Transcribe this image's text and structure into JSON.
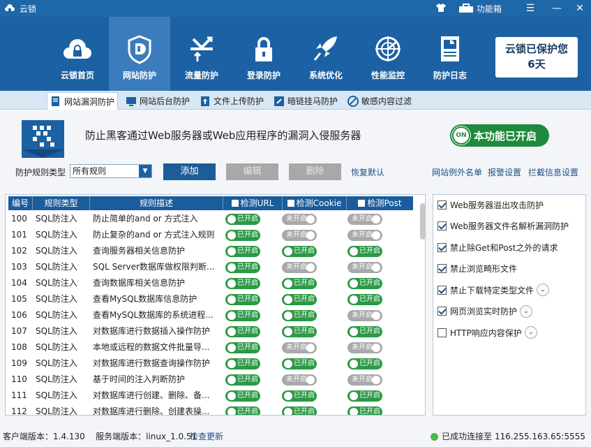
{
  "app": {
    "title": "云锁",
    "toolbox_label": "功能箱"
  },
  "nav": {
    "items": [
      {
        "label": "云锁首页",
        "icon": "cloud-lock-icon"
      },
      {
        "label": "网站防护",
        "icon": "shield-d-icon"
      },
      {
        "label": "流量防护",
        "icon": "traffic-icon"
      },
      {
        "label": "登录防护",
        "icon": "lock-icon"
      },
      {
        "label": "系统优化",
        "icon": "rocket-icon"
      },
      {
        "label": "性能监控",
        "icon": "radar-icon"
      },
      {
        "label": "防护日志",
        "icon": "report-icon"
      }
    ],
    "protect_line1": "云锁已保护您",
    "protect_line2": "6天"
  },
  "subnav": {
    "tabs": [
      {
        "label": "网站漏洞防护",
        "icon": "page-shield-icon"
      },
      {
        "label": "网站后台防护",
        "icon": "monitor-icon"
      },
      {
        "label": "文件上传防护",
        "icon": "upload-file-icon"
      },
      {
        "label": "暗链挂马防护",
        "icon": "link-icon"
      },
      {
        "label": "敏感内容过滤",
        "icon": "filter-icon"
      }
    ]
  },
  "banner": {
    "text": "防止黑客通过Web服务器或Web应用程序的漏洞入侵服务器",
    "status_on": "ON",
    "status_text": "本功能已开启"
  },
  "controls": {
    "rule_type_label": "防护规则类型",
    "rule_type_value": "所有规则",
    "add": "添加",
    "edit": "编辑",
    "delete": "删除",
    "restore": "恢复默认",
    "links": [
      "网站例外名单",
      "报警设置",
      "拦截信息设置"
    ]
  },
  "table": {
    "headers": [
      "编号",
      "规则类型",
      "规则描述",
      "检测URL",
      "检测Cookie",
      "检测Post"
    ],
    "on_label": "已开启",
    "off_label": "未开启",
    "rows": [
      {
        "id": "100",
        "type": "SQL防注入",
        "desc": "防止简单的and or 方式注入",
        "url": true,
        "cookie": false,
        "post": false
      },
      {
        "id": "101",
        "type": "SQL防注入",
        "desc": "防止复杂的and or 方式注入规则",
        "url": true,
        "cookie": false,
        "post": false
      },
      {
        "id": "102",
        "type": "SQL防注入",
        "desc": "查询服务器相关信息防护",
        "url": true,
        "cookie": true,
        "post": true
      },
      {
        "id": "103",
        "type": "SQL防注入",
        "desc": "SQL Server数据库做权限判断...",
        "url": true,
        "cookie": false,
        "post": false
      },
      {
        "id": "104",
        "type": "SQL防注入",
        "desc": "查询数据库相关信息防护",
        "url": true,
        "cookie": true,
        "post": true
      },
      {
        "id": "105",
        "type": "SQL防注入",
        "desc": "查看MySQL数据库信息防护",
        "url": true,
        "cookie": true,
        "post": true
      },
      {
        "id": "106",
        "type": "SQL防注入",
        "desc": "查看MySQL数据库的系统进程...",
        "url": true,
        "cookie": true,
        "post": false
      },
      {
        "id": "107",
        "type": "SQL防注入",
        "desc": "对数据库进行数据插入操作防护",
        "url": true,
        "cookie": true,
        "post": true
      },
      {
        "id": "108",
        "type": "SQL防注入",
        "desc": "本地或远程的数据文件批量导...",
        "url": true,
        "cookie": false,
        "post": false
      },
      {
        "id": "109",
        "type": "SQL防注入",
        "desc": "对数据库进行数据查询操作防护",
        "url": true,
        "cookie": true,
        "post": true
      },
      {
        "id": "110",
        "type": "SQL防注入",
        "desc": "基于时间的注入判断防护",
        "url": true,
        "cookie": false,
        "post": false
      },
      {
        "id": "111",
        "type": "SQL防注入",
        "desc": "对数据库进行创建、删除、备...",
        "url": true,
        "cookie": true,
        "post": true
      },
      {
        "id": "112",
        "type": "SQL防注入",
        "desc": "对数据库进行删除、创建表操...",
        "url": true,
        "cookie": true,
        "post": true
      }
    ]
  },
  "options": [
    {
      "label": "Web服务器溢出攻击防护",
      "checked": true,
      "expand": false
    },
    {
      "label": "Web服务器文件名解析漏洞防护",
      "checked": true,
      "expand": false
    },
    {
      "label": "禁止除Get和Post之外的请求",
      "checked": true,
      "expand": false
    },
    {
      "label": "禁止浏览畸形文件",
      "checked": true,
      "expand": false
    },
    {
      "label": "禁止下载特定类型文件",
      "checked": true,
      "expand": true
    },
    {
      "label": "网页浏览实时防护",
      "checked": true,
      "expand": true
    },
    {
      "label": "HTTP响应内容保护",
      "checked": false,
      "expand": true
    }
  ],
  "status": {
    "client_label": "客户端版本：",
    "client_version": "1.4.130",
    "server_label": "服务端版本：",
    "server_version": "linux_1.0.51",
    "check_update": "检查更新",
    "connected": "已成功连接至 116.255.163.65:5555"
  },
  "colors": {
    "nav_bg": "#1c61a3",
    "on_green": "#2a9a44",
    "off_gray": "#a9a9a9"
  }
}
